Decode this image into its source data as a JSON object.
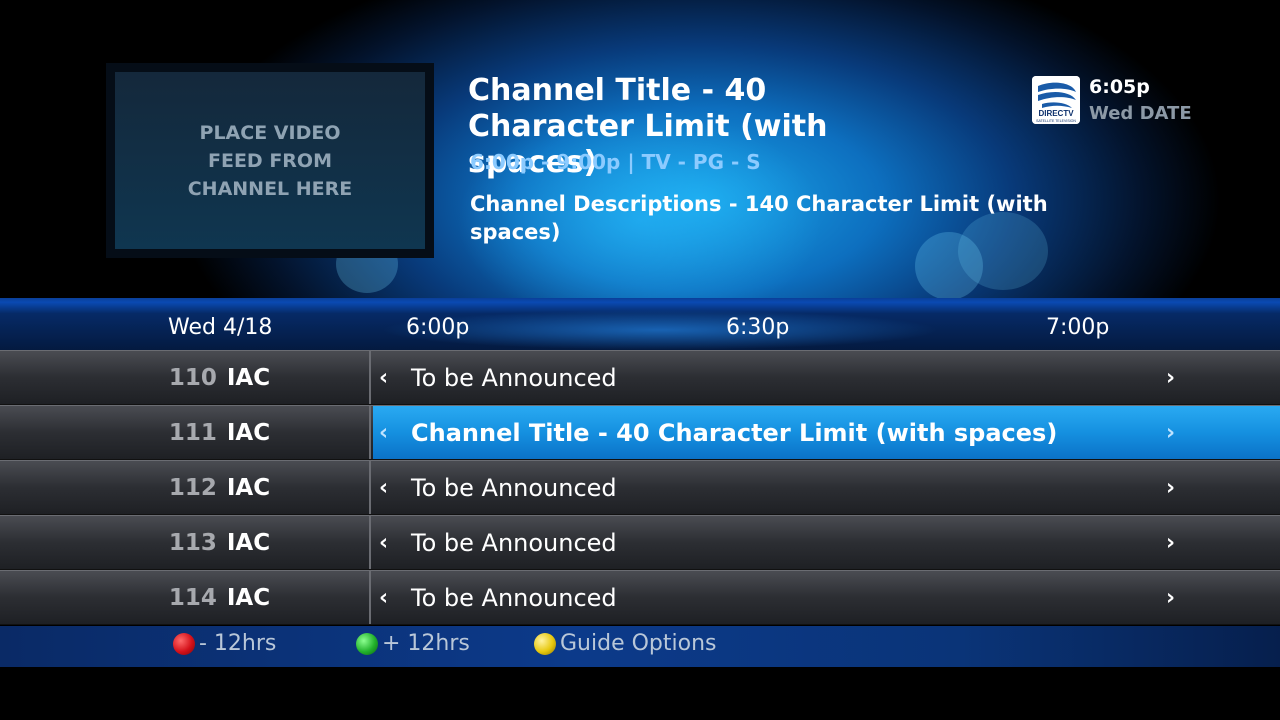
{
  "video": {
    "placeholder": "PLACE VIDEO\nFEED FROM\nCHANNEL HERE"
  },
  "info": {
    "title": "Channel Title - 40 Character Limit (with spaces)",
    "meta": "6:00p - 9:00p | TV - PG - S",
    "description": "Channel Descriptions - 140 Character Limit (with spaces)"
  },
  "clock": {
    "time": "6:05p",
    "date": "Wed DATE"
  },
  "logo": {
    "icon": "directv-logo",
    "text": "DIRECTV",
    "subtext": "SATELLITE TELEVISION"
  },
  "timeline": {
    "date": "Wed 4/18",
    "slots": [
      "6:00p",
      "6:30p",
      "7:00p"
    ]
  },
  "channels": [
    {
      "number": "110",
      "name": "IAC",
      "program": "To be Announced",
      "selected": false
    },
    {
      "number": "111",
      "name": "IAC",
      "program": "Channel Title - 40 Character Limit (with spaces)",
      "selected": true
    },
    {
      "number": "112",
      "name": "IAC",
      "program": "To be Announced",
      "selected": false
    },
    {
      "number": "113",
      "name": "IAC",
      "program": "To be Announced",
      "selected": false
    },
    {
      "number": "114",
      "name": "IAC",
      "program": "To be Announced",
      "selected": false
    }
  ],
  "arrows": {
    "left": "‹",
    "right": "›"
  },
  "legend": [
    {
      "color": "#d4111a",
      "label": "- 12hrs",
      "icon": "red-button-icon"
    },
    {
      "color": "#22b22c",
      "label": "+ 12hrs",
      "icon": "green-button-icon"
    },
    {
      "color": "#e7c80e",
      "label": "Guide Options",
      "icon": "yellow-button-icon"
    }
  ]
}
